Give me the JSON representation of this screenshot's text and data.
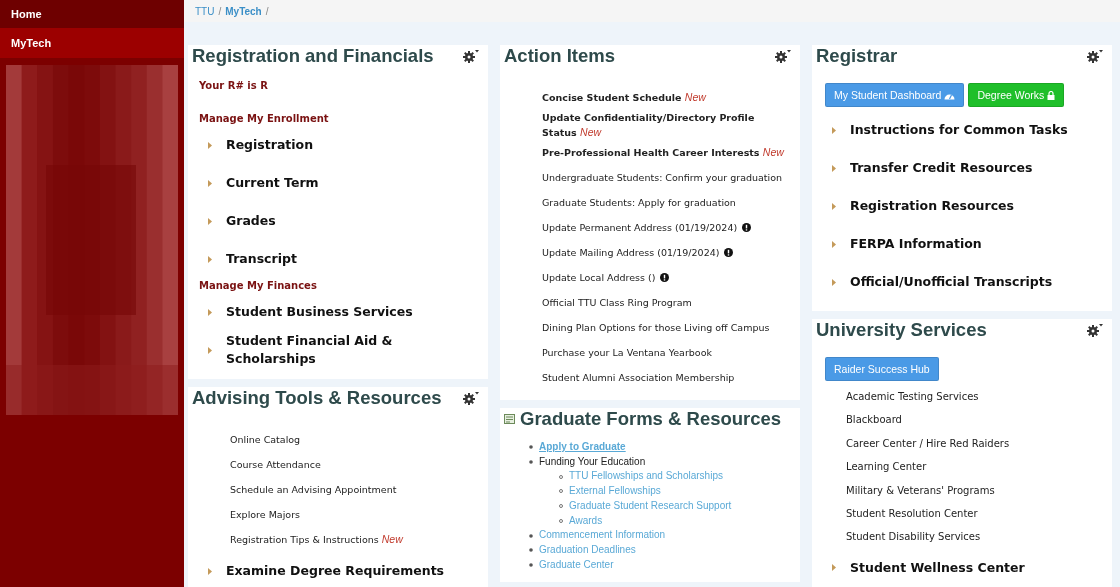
{
  "sidebar": {
    "items": [
      {
        "label": "Home",
        "selected": false
      },
      {
        "label": "MyTech",
        "selected": true
      }
    ]
  },
  "breadcrumb": {
    "separator": "/",
    "items": [
      "TTU",
      "MyTech"
    ]
  },
  "columns": [
    [
      {
        "title": "Registration and Financials",
        "settings": true,
        "items": [
          {
            "kind": "note",
            "text": "Your R# is R"
          },
          {
            "kind": "section",
            "text": "Manage My Enrollment"
          },
          {
            "kind": "arrow",
            "text": "Registration"
          },
          {
            "kind": "arrow",
            "text": "Current Term"
          },
          {
            "kind": "arrow",
            "text": "Grades"
          },
          {
            "kind": "arrow",
            "text": "Transcript"
          },
          {
            "kind": "section",
            "text": "Manage My Finances"
          },
          {
            "kind": "arrow",
            "text": "Student Business Services"
          },
          {
            "kind": "arrow",
            "text": "Student Financial Aid & Scholarships"
          }
        ]
      },
      {
        "title": "Advising Tools & Resources",
        "settings": true,
        "items": [
          {
            "kind": "plain",
            "text": "Online Catalog"
          },
          {
            "kind": "plain",
            "text": "Course Attendance"
          },
          {
            "kind": "plain",
            "text": "Schedule an Advising Appointment"
          },
          {
            "kind": "plain",
            "text": "Explore Majors"
          },
          {
            "kind": "plain",
            "text": "Registration Tips & Instructions",
            "badge": "New"
          },
          {
            "kind": "arrow",
            "text": "Examine Degree Requirements"
          }
        ]
      }
    ],
    [
      {
        "title": "Action Items",
        "settings": true,
        "items": [
          {
            "kind": "strong",
            "text": "Concise Student Schedule",
            "badge": "New"
          },
          {
            "kind": "strong",
            "text": "Update Confidentiality/Directory Profile Status",
            "badge": "New"
          },
          {
            "kind": "strong",
            "text": "Pre-Professional Health Career Interests",
            "badge": "New"
          },
          {
            "kind": "plain",
            "text": "Undergraduate Students: Confirm your graduation"
          },
          {
            "kind": "plain",
            "text": "Graduate Students: Apply for graduation"
          },
          {
            "kind": "plain",
            "text": "Update Permanent Address (01/19/2024)",
            "alert": true
          },
          {
            "kind": "plain",
            "text": "Update Mailing Address (01/19/2024)",
            "alert": true
          },
          {
            "kind": "plain",
            "text": "Update Local Address ()",
            "alert": true
          },
          {
            "kind": "plain",
            "text": "Official TTU Class Ring Program"
          },
          {
            "kind": "plain",
            "text": "Dining Plan Options for those Living off Campus"
          },
          {
            "kind": "plain",
            "text": "Purchase your La Ventana Yearbook"
          },
          {
            "kind": "plain",
            "text": "Student Alumni Association Membership"
          }
        ]
      },
      {
        "title": "Graduate Forms & Resources",
        "settings": false,
        "items": [
          {
            "kind": "tree",
            "entries": [
              {
                "text": "Apply to Graduate",
                "kind": "visited"
              },
              {
                "text": "Funding Your Education",
                "kind": "text",
                "children": [
                  {
                    "text": "TTU Fellowships and Scholarships",
                    "kind": "link"
                  },
                  {
                    "text": "External Fellowships",
                    "kind": "link"
                  },
                  {
                    "text": "Graduate Student Research Support",
                    "kind": "link"
                  },
                  {
                    "text": "Awards",
                    "kind": "link"
                  }
                ]
              },
              {
                "text": "Commencement Information",
                "kind": "link"
              },
              {
                "text": "Graduation Deadlines",
                "kind": "link"
              },
              {
                "text": "Graduate Center",
                "kind": "link"
              }
            ]
          }
        ]
      }
    ],
    [
      {
        "title": "Registrar",
        "settings": true,
        "items": [
          {
            "kind": "buttons",
            "buttons": [
              {
                "label": "My Student Dashboard",
                "color": "#4a9ae6"
              },
              {
                "label": "Degree Works",
                "color": "#1fbf2a"
              }
            ]
          },
          {
            "kind": "arrow",
            "text": "Instructions for Common Tasks"
          },
          {
            "kind": "arrow",
            "text": "Transfer Credit Resources"
          },
          {
            "kind": "arrow",
            "text": "Registration Resources"
          },
          {
            "kind": "arrow",
            "text": "FERPA Information"
          },
          {
            "kind": "arrow",
            "text": "Official/Unofficial Transcripts"
          }
        ]
      },
      {
        "title": "University Services",
        "settings": true,
        "items": [
          {
            "kind": "buttons",
            "buttons": [
              {
                "label": "Raider Success Hub",
                "color": "#4a9ae6"
              }
            ]
          },
          {
            "kind": "service",
            "text": "Academic Testing Services"
          },
          {
            "kind": "service",
            "text": "Blackboard"
          },
          {
            "kind": "service",
            "text": "Career Center / Hire Red Raiders"
          },
          {
            "kind": "service",
            "text": "Learning Center"
          },
          {
            "kind": "service",
            "text": "Military & Veterans' Programs"
          },
          {
            "kind": "service",
            "text": "Student Resolution Center"
          },
          {
            "kind": "service",
            "text": "Student Disability Services"
          },
          {
            "kind": "arrow",
            "text": "Student Wellness Center"
          }
        ]
      }
    ]
  ]
}
